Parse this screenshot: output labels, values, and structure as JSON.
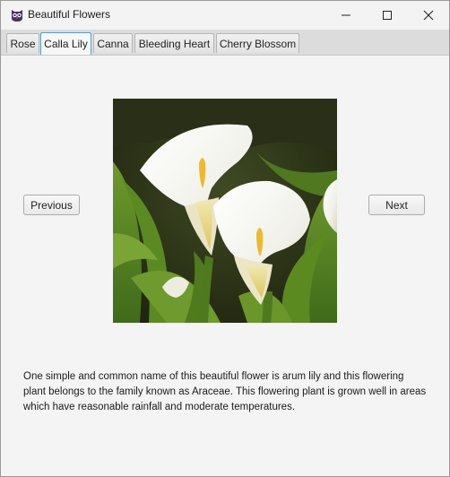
{
  "window": {
    "title": "Beautiful Flowers",
    "app_icon": "owl-app-icon",
    "controls": [
      "minimize-icon",
      "maximize-icon",
      "close-icon"
    ]
  },
  "tabs": [
    {
      "label": "Rose",
      "selected": false
    },
    {
      "label": "Calla Lily",
      "selected": true
    },
    {
      "label": "Canna",
      "selected": false
    },
    {
      "label": "Bleeding Heart",
      "selected": false
    },
    {
      "label": "Cherry Blossom",
      "selected": false
    }
  ],
  "content": {
    "previous_label": "Previous",
    "next_label": "Next",
    "description": "One simple and common name of this beautiful flower is arum lily and this flowering plant belongs to the family known as Araceae. This flowering plant is grown well in areas which have reasonable rainfall and moderate temperatures."
  },
  "colors": {
    "active_tab_border": "#4aa3d8",
    "tabstrip_bg": "#dcdcdc",
    "content_bg": "#f4f4f4"
  }
}
